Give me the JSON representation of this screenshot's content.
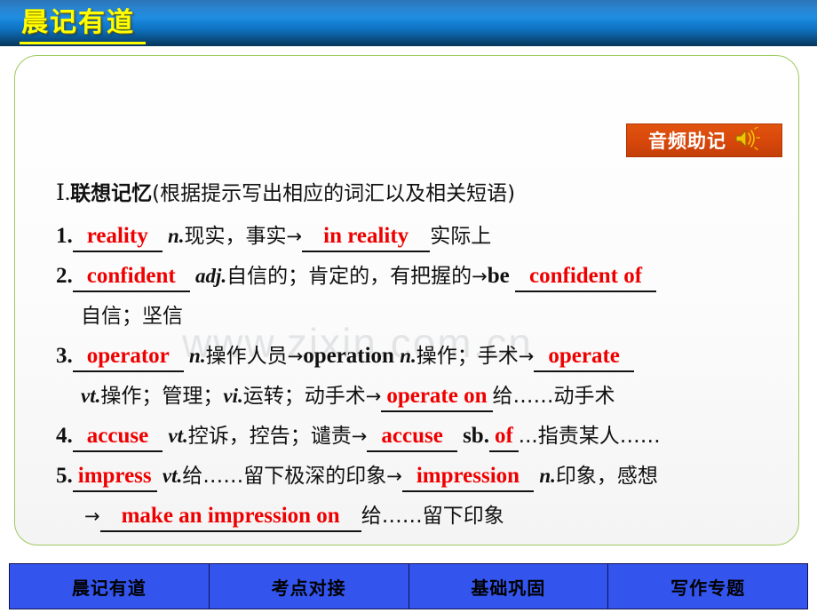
{
  "header": {
    "title": "晨记有道"
  },
  "panel": {
    "watermark": "www.zixin.com.cn",
    "audio_badge": {
      "label": "音频助记",
      "icon": "speaker-icon"
    },
    "heading": {
      "roman": "Ⅰ",
      "dot": ".",
      "title": "联想记忆",
      "note": "(根据提示写出相应的词汇以及相关短语)"
    },
    "items": [
      {
        "number": "1.",
        "answer1": "reality",
        "pos1": "n.",
        "meaning1": "现实，事实",
        "arrow": "→",
        "answer2": "in reality",
        "meaning2": "实际上"
      },
      {
        "number": "2.",
        "answer1": "confident",
        "pos1": "adj.",
        "meaning1": "自信的；肯定的，有把握的",
        "arrow": "→",
        "lead": "be",
        "answer2": "confident of",
        "cont": "自信；坚信"
      },
      {
        "number": "3.",
        "answer1": "operator",
        "pos1": "n.",
        "meaning1": "操作人员",
        "arrow": "→",
        "word2": "operation",
        "pos2": "n.",
        "meaning2": "操作；手术",
        "arrow2": "→",
        "answer2": "operate",
        "cont_pos": "vt.",
        "cont_meaning": "操作；管理；",
        "cont_pos2": "vi.",
        "cont_meaning2": "运转；动手术",
        "cont_arrow": "→",
        "answer3": "operate on",
        "cont_tail": "给……动手术"
      },
      {
        "number": "4.",
        "answer1": "accuse",
        "pos1": "vt.",
        "meaning1": "控诉，控告；谴责",
        "arrow": "→",
        "answer2": "accuse",
        "mid": "sb.",
        "answer3": "of",
        "tail": "...指责某人……"
      },
      {
        "number": "5.",
        "answer1": "impress",
        "pos1": "vt.",
        "meaning1": "给……留下极深的印象",
        "arrow": "→",
        "answer2": "impression",
        "pos2": "n.",
        "meaning2": "印象，感想",
        "arrow2": "→",
        "answer3": "make an impression on",
        "tail": "给……留下印象"
      }
    ]
  },
  "footer": {
    "tabs": [
      {
        "label": "晨记有道"
      },
      {
        "label": "考点对接"
      },
      {
        "label": "基础巩固"
      },
      {
        "label": "写作专题"
      }
    ]
  }
}
